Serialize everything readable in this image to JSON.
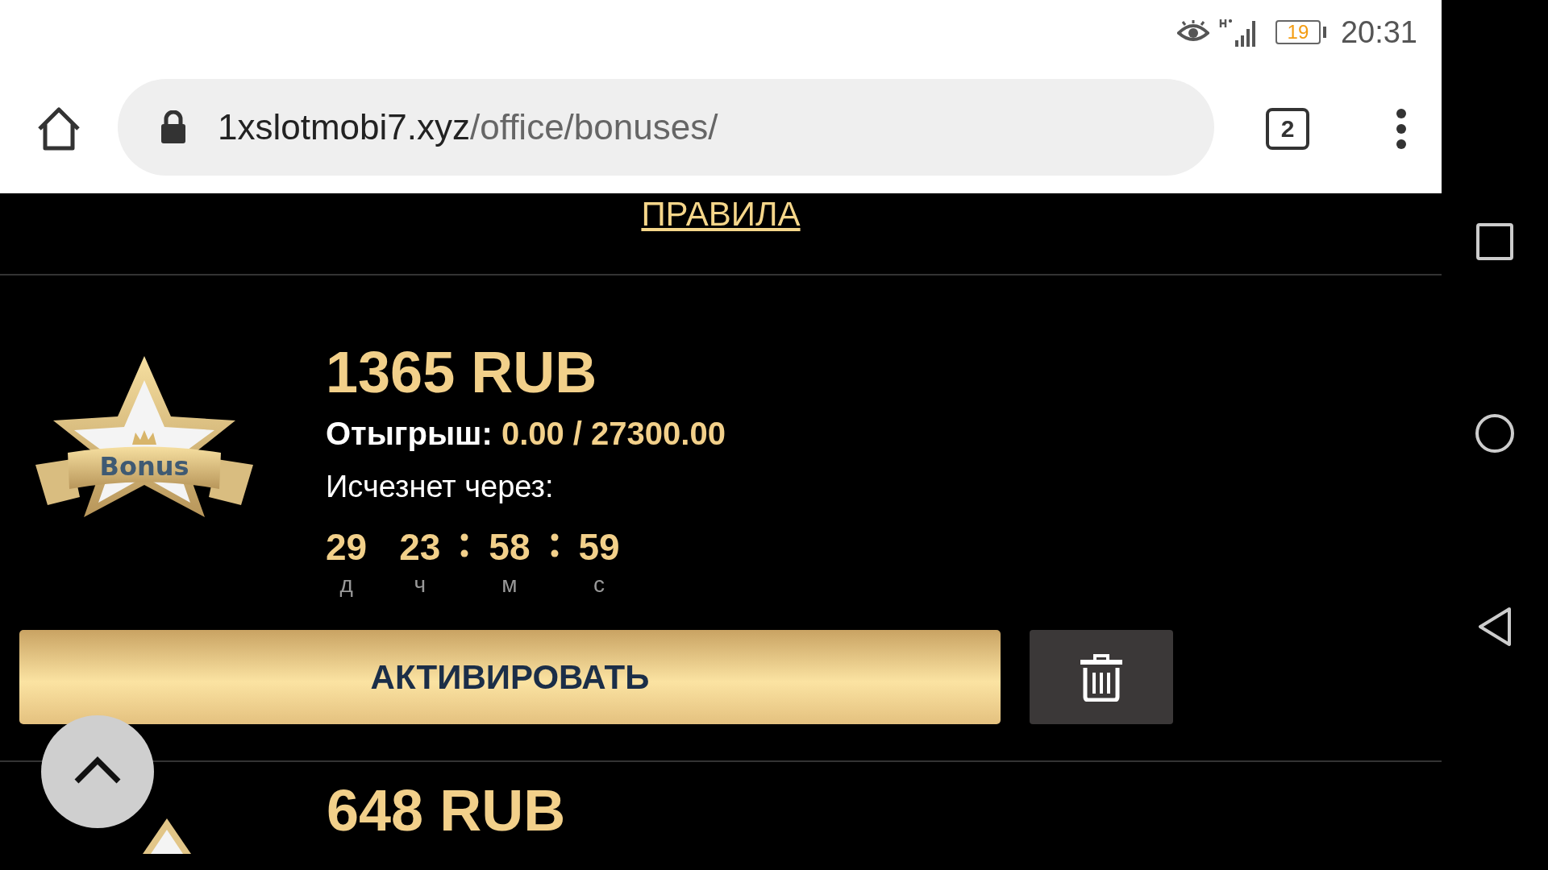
{
  "status_bar": {
    "battery": "19",
    "time": "20:31"
  },
  "address_bar": {
    "domain": "1xslotmobi7.xyz",
    "path": "/office/bonuses/",
    "tab_count": "2"
  },
  "rules_link": "ПРАВИЛА",
  "bonuses": [
    {
      "amount": "1365 RUB",
      "wagering_label": "Отыгрыш:",
      "wagering_value": "0.00 / 27300.00",
      "expires_label": "Исчезнет через:",
      "badge_text": "Bonus",
      "countdown": [
        {
          "value": "29",
          "unit": "д",
          "colon_before": false
        },
        {
          "value": "23",
          "unit": "ч",
          "colon_before": false
        },
        {
          "value": "58",
          "unit": "м",
          "colon_before": true
        },
        {
          "value": "59",
          "unit": "с",
          "colon_before": true
        }
      ],
      "activate_label": "АКТИВИРОВАТЬ"
    },
    {
      "amount": "648 RUB"
    }
  ]
}
